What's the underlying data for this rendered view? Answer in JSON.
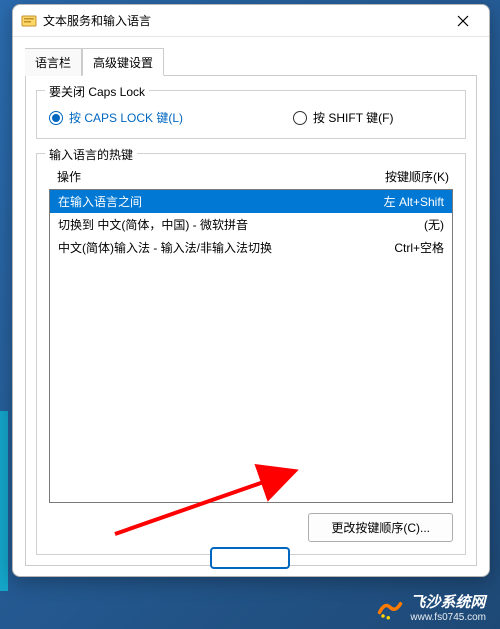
{
  "window": {
    "title": "文本服务和输入语言"
  },
  "tabs": {
    "language_bar": "语言栏",
    "advanced_keys": "高级键设置"
  },
  "capslock_group": {
    "title": "要关闭 Caps Lock",
    "option_caps": "按 CAPS LOCK 键(L)",
    "option_shift": "按 SHIFT 键(F)"
  },
  "hotkey_group": {
    "title": "输入语言的热键",
    "header_action": "操作",
    "header_key": "按键顺序(K)",
    "rows": [
      {
        "action": "在输入语言之间",
        "key": "左 Alt+Shift"
      },
      {
        "action": "切换到 中文(简体，中国) - 微软拼音",
        "key": "(无)"
      },
      {
        "action": "中文(简体)输入法 - 输入法/非输入法切换",
        "key": "Ctrl+空格"
      }
    ],
    "change_button": "更改按键顺序(C)..."
  },
  "watermark": {
    "name": "飞沙系统网",
    "url": "www.fs0745.com"
  }
}
